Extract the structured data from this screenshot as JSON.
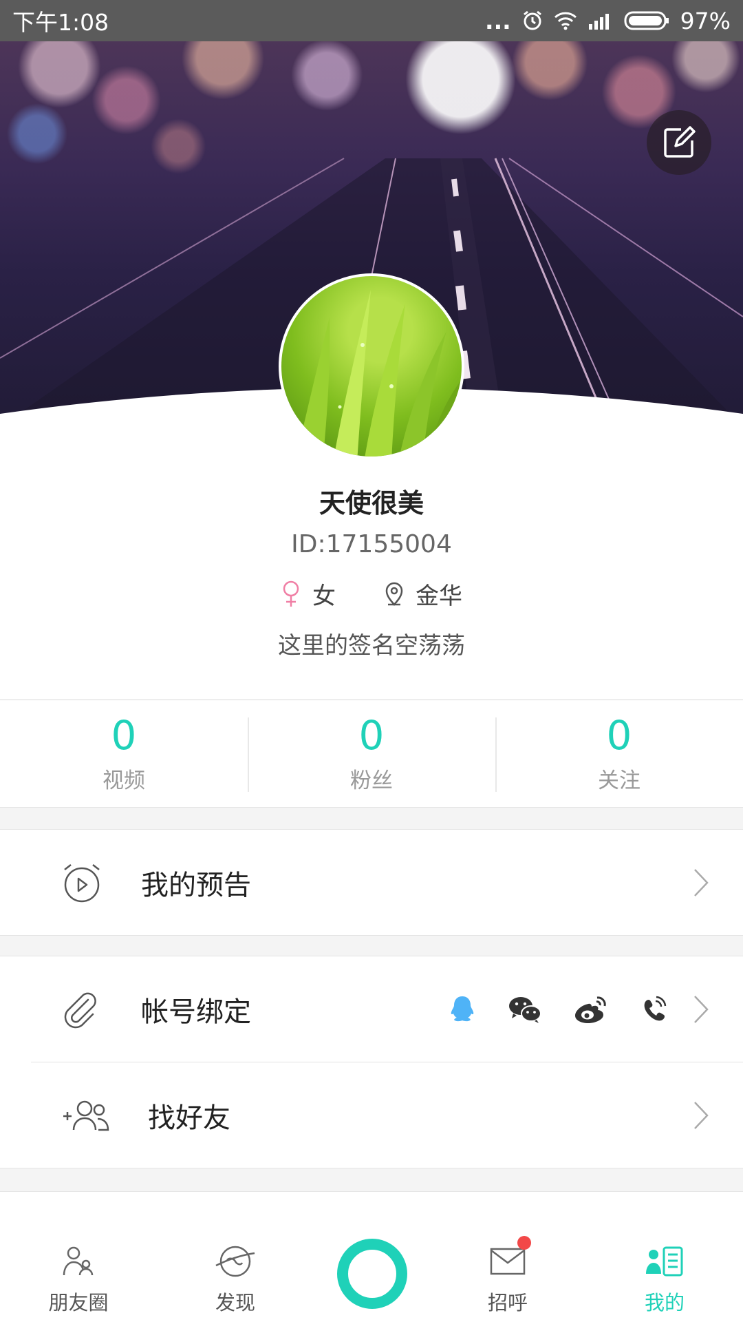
{
  "status_bar": {
    "time": "下午1:08",
    "dots": "...",
    "battery": "97%",
    "icons": [
      "alarm-icon",
      "wifi-icon",
      "signal-icon",
      "battery-icon"
    ]
  },
  "profile": {
    "name": "天使很美",
    "id": "ID:17155004",
    "gender": "女",
    "location": "金华",
    "signature": "这里的签名空荡荡"
  },
  "stats": [
    {
      "value": "0",
      "label": "视频"
    },
    {
      "value": "0",
      "label": "粉丝"
    },
    {
      "value": "0",
      "label": "关注"
    }
  ],
  "menu": {
    "preview": "我的预告",
    "account_binding": "帐号绑定",
    "find_friends": "找好友",
    "binding_icons": [
      "qq-icon",
      "wechat-icon",
      "weibo-icon",
      "phone-icon"
    ]
  },
  "bottom_nav": {
    "items": [
      {
        "label": "朋友圈",
        "icon": "friends-icon"
      },
      {
        "label": "发现",
        "icon": "discover-icon"
      },
      {
        "label": "招呼",
        "icon": "mail-icon"
      },
      {
        "label": "我的",
        "icon": "profile-icon",
        "active": true
      }
    ]
  },
  "colors": {
    "accent": "#1fd1b8",
    "badge": "#f24848",
    "female": "#f07fa5",
    "qq": "#4fb3f7"
  }
}
